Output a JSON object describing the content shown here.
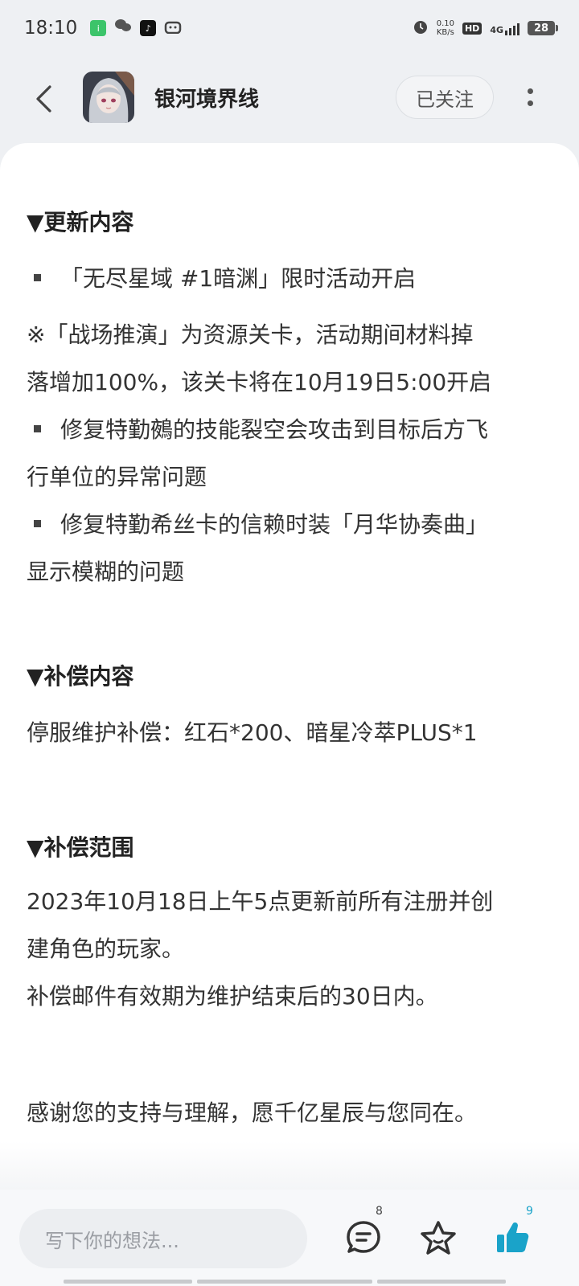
{
  "status_bar": {
    "time": "18:10",
    "net_speed_value": "0.10",
    "net_speed_unit": "KB/s",
    "hd": "HD",
    "network": "4G",
    "battery": "28"
  },
  "header": {
    "title": "银河境界线",
    "follow_label": "已关注"
  },
  "content": {
    "update_heading": "▼更新内容",
    "update_item_1": "「无尽星域 #1暗渊」限时活动开启",
    "update_note_line1": "※「战场推演」为资源关卡，活动期间材料掉",
    "update_note_line2": "落增加100%，该关卡将在10月19日5:00开启",
    "fix_1_line1": "修复特勤鵺的技能裂空会攻击到目标后方飞",
    "fix_1_line2": "行单位的异常问题",
    "fix_2_line1": "修复特勤希丝卡的信赖时装「月华协奏曲」",
    "fix_2_line2": "显示模糊的问题",
    "comp_heading": "▼补偿内容",
    "comp_text": "停服维护补偿：红石*200、暗星冷萃PLUS*1",
    "scope_heading": "▼补偿范围",
    "scope_line1": "2023年10月18日上午5点更新前所有注册并创",
    "scope_line2": "建角色的玩家。",
    "scope_line3": "补偿邮件有效期为维护结束后的30日内。",
    "thanks": "感谢您的支持与理解，愿千亿星辰与您同在。"
  },
  "bottom_bar": {
    "comment_placeholder": "写下你的想法...",
    "comment_count": "8",
    "like_count": "9"
  },
  "colors": {
    "accent_like": "#1aa3c9",
    "page_bg": "#eef0f3",
    "card_bg": "#ffffff"
  },
  "icons": {
    "back": "chevron-left-icon",
    "more": "more-vertical-icon",
    "comment": "comment-icon",
    "favorite": "star-icon",
    "like": "thumbs-up-icon"
  }
}
